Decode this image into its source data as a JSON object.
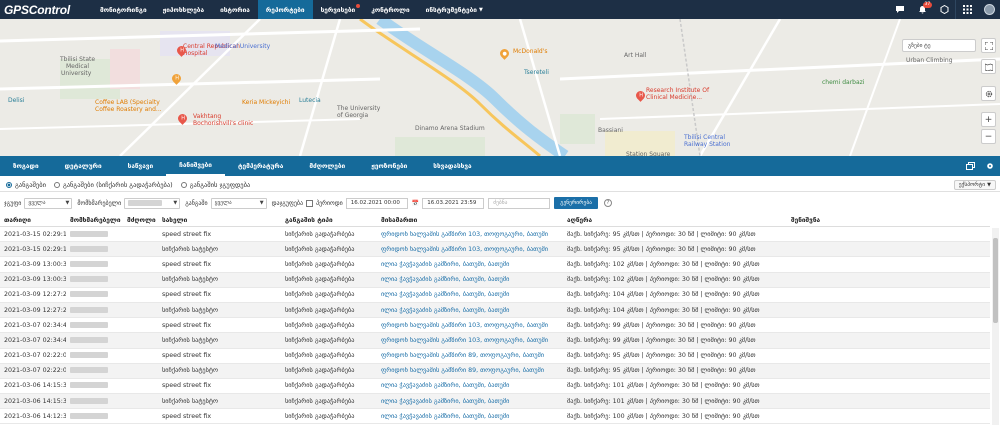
{
  "brand": "GPSControl",
  "nav": [
    {
      "label": "მონიტორინგი",
      "active": false
    },
    {
      "label": "ჟიპოხსლება",
      "active": false
    },
    {
      "label": "ისტორია",
      "active": false
    },
    {
      "label": "რეპორტები",
      "active": true
    },
    {
      "label": "სერვისები",
      "active": false,
      "dot": true
    },
    {
      "label": "კონტროლი",
      "active": false
    },
    {
      "label": "ინსტრუმენტები",
      "active": false,
      "caret": true
    }
  ],
  "notifications_count": "37",
  "map": {
    "search_placeholder": "გზები ტე",
    "labels": [
      {
        "text": "Central Republican",
        "cls": "red"
      },
      {
        "text": "Hospital",
        "cls": "red"
      },
      {
        "text": "Tbilisi State",
        "cls": "gray"
      },
      {
        "text": "Medical",
        "cls": "gray"
      },
      {
        "text": "University",
        "cls": "gray"
      },
      {
        "text": "Medical University",
        "cls": "blue"
      },
      {
        "text": "Coffee LAB (Specialty",
        "cls": "orange"
      },
      {
        "text": "Coffee Roastery and...",
        "cls": "orange"
      },
      {
        "text": "Vakhtang",
        "cls": "red"
      },
      {
        "text": "Bochorishvili's clinic",
        "cls": "red"
      },
      {
        "text": "Keria Mickeyichi",
        "cls": "orange"
      },
      {
        "text": "Lutecia",
        "cls": "teal"
      },
      {
        "text": "The University",
        "cls": "gray"
      },
      {
        "text": "of Georgia",
        "cls": "gray"
      },
      {
        "text": "McDonald's",
        "cls": "orange"
      },
      {
        "text": "Tsereteli",
        "cls": "teal"
      },
      {
        "text": "Dinamo Arena Stadium",
        "cls": "gray"
      },
      {
        "text": "Bassiani",
        "cls": "gray"
      },
      {
        "text": "Art Hall",
        "cls": "gray"
      },
      {
        "text": "Research Institute Of",
        "cls": "red"
      },
      {
        "text": "Clinical Medicine...",
        "cls": "red"
      },
      {
        "text": "Tbilisi Central",
        "cls": "blue"
      },
      {
        "text": "Railway Station",
        "cls": "blue"
      },
      {
        "text": "chemi darbazi",
        "cls": "green"
      },
      {
        "text": "Urban Climbing",
        "cls": "gray"
      },
      {
        "text": "Delisi",
        "cls": "teal"
      },
      {
        "text": "Station Square",
        "cls": "gray"
      }
    ]
  },
  "tabs": [
    {
      "label": "ზოგადი",
      "active": false
    },
    {
      "label": "დეტალური",
      "active": false
    },
    {
      "label": "საწვავი",
      "active": false
    },
    {
      "label": "ჩანიშვები",
      "active": true
    },
    {
      "label": "ტემპერატურა",
      "active": false
    },
    {
      "label": "მძღოლები",
      "active": false
    },
    {
      "label": "ჟეოზონები",
      "active": false
    },
    {
      "label": "სხვადასხვა",
      "active": false
    }
  ],
  "radios": [
    {
      "label": "განგაშები",
      "on": true
    },
    {
      "label": "განგაშები (სიჩქარის გადაჭარბება)",
      "on": false
    },
    {
      "label": "განგაშის ჯგუფდება",
      "on": false
    }
  ],
  "export_label": "ექსპორტი",
  "filters": {
    "group_label": "ჯგუფი",
    "group_value": "ყველა",
    "driver_label": "მომხმარებელი",
    "alarm_label": "განგაში",
    "alarm_value": "ყველა",
    "watch_label": "დაჯგუფება",
    "from_label": "პერიოდი",
    "from_value": "16.02.2021 00:00",
    "to_value": "16.03.2021 23:59",
    "search_placeholder": "ძებნა",
    "generate_label": "გენერირება",
    "help": "?"
  },
  "columns": [
    "თარიღი",
    "მომხმარებელი",
    "მძღოლი",
    "სახელი",
    "განგაშის ტიპი",
    "მისამართი",
    "აღწერა",
    "შენიშვნა"
  ],
  "rows": [
    {
      "date": "2021-03-15 02:29:13",
      "name": "speed street fix",
      "type": "სიჩქარის გადაჭარბება",
      "address": "ფრიდონ ხალვაშის გამზირი 103, თოფოგაური, ბათუმი",
      "desc": "მაქს. სიჩქარე: 95 კმ/სთ | პერიოდი: 30 წმ | ლიმიტი: 90 კმ/სთ"
    },
    {
      "date": "2021-03-15 02:29:13",
      "name": "სიჩქარის სატესტო",
      "type": "სიჩქარის გადაჭარბება",
      "address": "ფრიდონ ხალვაშის გამზირი 103, თოფოგაური, ბათუმი",
      "desc": "მაქს. სიჩქარე: 95 კმ/სთ | პერიოდი: 30 წმ | ლიმიტი: 90 კმ/სთ"
    },
    {
      "date": "2021-03-09 13:00:39",
      "name": "speed street fix",
      "type": "სიჩქარის გადაჭარბება",
      "address": "ილია ჭავჭავაძის გამზირი, ბათუმი, ბათუმი",
      "desc": "მაქს. სიჩქარე: 102 კმ/სთ | პერიოდი: 30 წმ | ლიმიტი: 90 კმ/სთ"
    },
    {
      "date": "2021-03-09 13:00:39",
      "name": "სიჩქარის სატესტო",
      "type": "სიჩქარის გადაჭარბება",
      "address": "ილია ჭავჭავაძის გამზირი, ბათუმი, ბათუმი",
      "desc": "მაქს. სიჩქარე: 102 კმ/სთ | პერიოდი: 30 წმ | ლიმიტი: 90 კმ/სთ"
    },
    {
      "date": "2021-03-09 12:27:21",
      "name": "speed street fix",
      "type": "სიჩქარის გადაჭარბება",
      "address": "ილია ჭავჭავაძის გამზირი, ბათუმი, ბათუმი",
      "desc": "მაქს. სიჩქარე: 104 კმ/სთ | პერიოდი: 30 წმ | ლიმიტი: 90 კმ/სთ"
    },
    {
      "date": "2021-03-09 12:27:21",
      "name": "სიჩქარის სატესტო",
      "type": "სიჩქარის გადაჭარბება",
      "address": "ილია ჭავჭავაძის გამზირი, ბათუმი, ბათუმი",
      "desc": "მაქს. სიჩქარე: 104 კმ/სთ | პერიოდი: 30 წმ | ლიმიტი: 90 კმ/სთ"
    },
    {
      "date": "2021-03-07 02:34:44",
      "name": "speed street fix",
      "type": "სიჩქარის გადაჭარბება",
      "address": "ფრიდონ ხალვაშის გამზირი 103, თოფოგაური, ბათუმი",
      "desc": "მაქს. სიჩქარე: 99 კმ/სთ | პერიოდი: 30 წმ | ლიმიტი: 90 კმ/სთ"
    },
    {
      "date": "2021-03-07 02:34:44",
      "name": "სიჩქარის სატესტო",
      "type": "სიჩქარის გადაჭარბება",
      "address": "ფრიდონ ხალვაშის გამზირი 103, თოფოგაური, ბათუმი",
      "desc": "მაქს. სიჩქარე: 99 კმ/სთ | პერიოდი: 30 წმ | ლიმიტი: 90 კმ/სთ"
    },
    {
      "date": "2021-03-07 02:22:04",
      "name": "speed street fix",
      "type": "სიჩქარის გადაჭარბება",
      "address": "ფრიდონ ხალვაშის გამზირი 89, თოფოგაური, ბათუმი",
      "desc": "მაქს. სიჩქარე: 95 კმ/სთ | პერიოდი: 30 წმ | ლიმიტი: 90 კმ/სთ"
    },
    {
      "date": "2021-03-07 02:22:04",
      "name": "სიჩქარის სატესტო",
      "type": "სიჩქარის გადაჭარბება",
      "address": "ფრიდონ ხალვაშის გამზირი 89, თოფოგაური, ბათუმი",
      "desc": "მაქს. სიჩქარე: 95 კმ/სთ | პერიოდი: 30 წმ | ლიმიტი: 90 კმ/სთ"
    },
    {
      "date": "2021-03-06 14:15:37",
      "name": "speed street fix",
      "type": "სიჩქარის გადაჭარბება",
      "address": "ილია ჭავჭავაძის გამზირი, ბათუმი, ბათუმი",
      "desc": "მაქს. სიჩქარე: 101 კმ/სთ | პერიოდი: 30 წმ | ლიმიტი: 90 კმ/სთ"
    },
    {
      "date": "2021-03-06 14:15:37",
      "name": "სიჩქარის სატესტო",
      "type": "სიჩქარის გადაჭარბება",
      "address": "ილია ჭავჭავაძის გამზირი, ბათუმი, ბათუმი",
      "desc": "მაქს. სიჩქარე: 101 კმ/სთ | პერიოდი: 30 წმ | ლიმიტი: 90 კმ/სთ"
    },
    {
      "date": "2021-03-06 14:12:37",
      "name": "speed street fix",
      "type": "სიჩქარის გადაჭარბება",
      "address": "ილია ჭავჭავაძის გამზირი, ბათუმი, ბათუმი",
      "desc": "მაქს. სიჩქარე: 100 კმ/სთ | პერიოდი: 30 წმ | ლიმიტი: 90 კმ/სთ"
    }
  ],
  "colors": {
    "navbar": "#1d2f45",
    "accent": "#156a9a",
    "link": "#1b6fa8"
  }
}
